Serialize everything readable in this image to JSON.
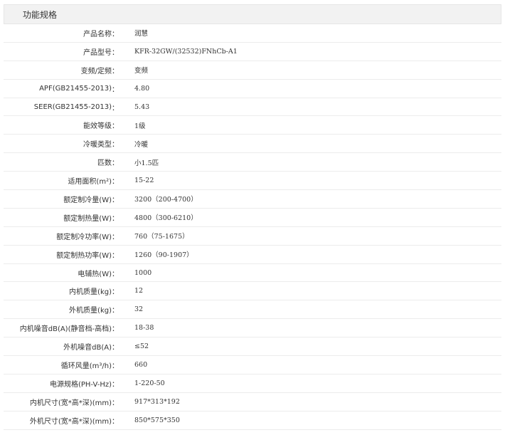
{
  "section": {
    "title": "功能规格"
  },
  "specs": [
    {
      "label": "产品名称",
      "value": "润慧"
    },
    {
      "label": "产品型号",
      "value": "KFR-32GW/(32532)FNhCb-A1"
    },
    {
      "label": "变频/定频",
      "value": "变频"
    },
    {
      "label": "APF(GB21455-2013)",
      "value": "4.80"
    },
    {
      "label": "SEER(GB21455-2013)",
      "value": "5.43"
    },
    {
      "label": "能效等级",
      "value": "1级"
    },
    {
      "label": "冷暖类型",
      "value": "冷暖"
    },
    {
      "label": "匹数",
      "value": "小1.5匹"
    },
    {
      "label": "适用面积(m²)",
      "value": "15-22"
    },
    {
      "label": "额定制冷量(W)",
      "value": "3200（200-4700）"
    },
    {
      "label": "额定制热量(W)",
      "value": "4800（300-6210）"
    },
    {
      "label": "额定制冷功率(W)",
      "value": "760（75-1675）"
    },
    {
      "label": "额定制热功率(W)",
      "value": "1260（90-1907）"
    },
    {
      "label": "电辅热(W)",
      "value": "1000"
    },
    {
      "label": "内机质量(kg)",
      "value": "12"
    },
    {
      "label": "外机质量(kg)",
      "value": "32"
    },
    {
      "label": "内机噪音dB(A)(静音档-高档)",
      "value": "18-38"
    },
    {
      "label": "外机噪音dB(A)",
      "value": "≤52"
    },
    {
      "label": "循环风量(m³/h)",
      "value": "660"
    },
    {
      "label": "电源规格(PH-V-Hz)",
      "value": "1-220-50"
    },
    {
      "label": "内机尺寸(宽*高*深)(mm)",
      "value": "917*313*192"
    },
    {
      "label": "外机尺寸(宽*高*深)(mm)",
      "value": "850*575*350"
    }
  ],
  "separator": "："
}
